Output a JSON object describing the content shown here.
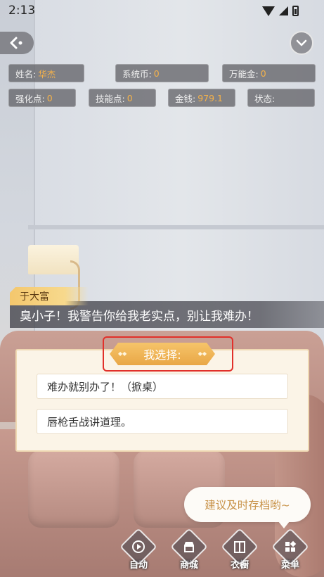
{
  "status_bar": {
    "time": "2:13"
  },
  "stats": {
    "name_label": "姓名:",
    "name_value": "华杰",
    "system_coin_label": "系统币:",
    "system_coin_value": "0",
    "universal_gold_label": "万能金:",
    "universal_gold_value": "0",
    "enhance_points_label": "强化点:",
    "enhance_points_value": "0",
    "skill_points_label": "技能点:",
    "skill_points_value": "0",
    "money_label": "金钱:",
    "money_value": "979.1",
    "status_label": "状态:",
    "status_value": ""
  },
  "dialogue": {
    "speaker": "于大富",
    "text": "臭小子！我警告你给我老实点，别让我难办！"
  },
  "choice": {
    "title": "我选择:",
    "options": [
      "难办就别办了！（掀桌）",
      "唇枪舌战讲道理。"
    ]
  },
  "hint": {
    "text": "建议及时存档哟~"
  },
  "menu": [
    {
      "label": "自动",
      "icon": "auto-play-icon"
    },
    {
      "label": "商城",
      "icon": "shop-icon"
    },
    {
      "label": "衣橱",
      "icon": "wardrobe-icon"
    },
    {
      "label": "菜单",
      "icon": "menu-grid-icon"
    }
  ],
  "colors": {
    "accent": "#f5b24a",
    "highlight_box": "#e1302a",
    "hint_text": "#c89248"
  }
}
